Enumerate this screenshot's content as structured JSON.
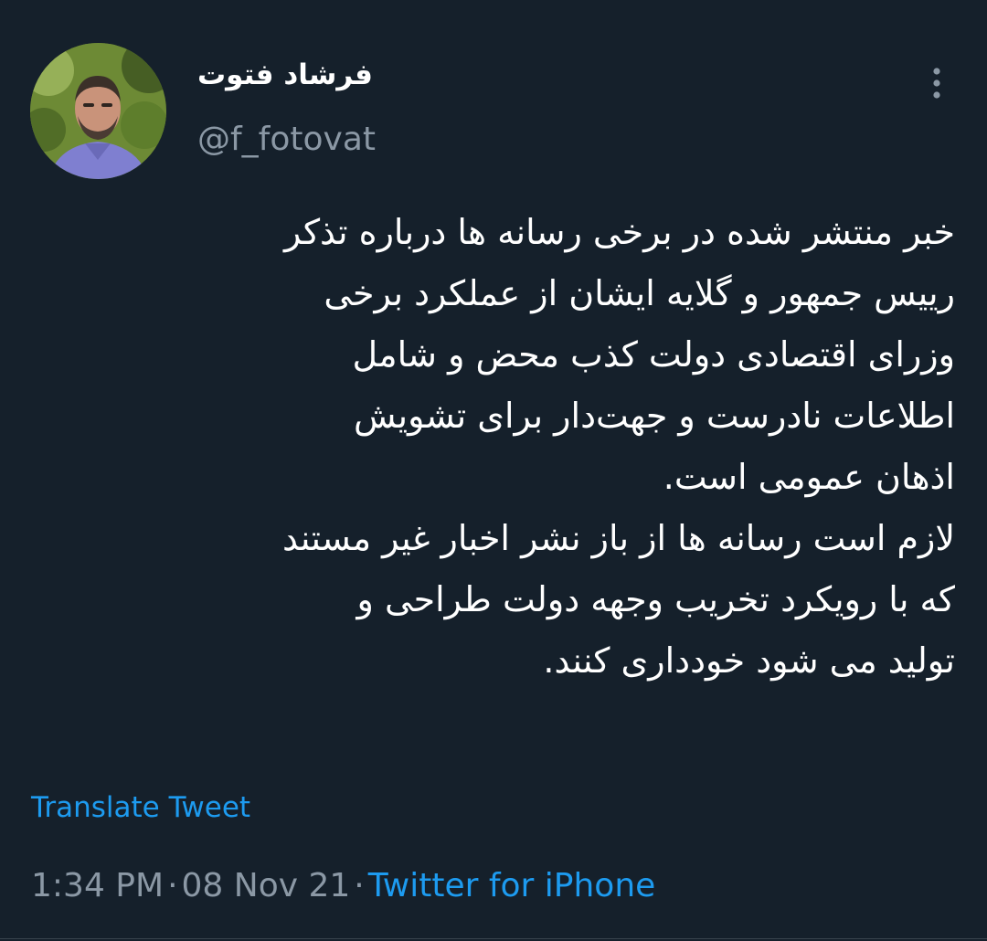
{
  "tweet": {
    "author": {
      "display_name": "فرشاد فتوت",
      "handle": "@f_fotovat"
    },
    "body_lines": [
      "خبر منتشر شده در برخی رسانه ها درباره تذکر",
      "رییس جمهور و گلایه ایشان از عملکرد برخی",
      "وزرای اقتصادی دولت کذب محض و شامل",
      "اطلاعات نادرست و جهت‌دار برای تشویش",
      "اذهان عمومی است.",
      "لازم است رسانه ها از باز نشر اخبار غیر مستند",
      "که با رویکرد تخریب وجهه دولت طراحی و",
      "تولید می شود خودداری کنند."
    ],
    "translate_label": "Translate Tweet",
    "time": "1:34 PM",
    "date": "08 Nov 21",
    "separator": "·",
    "source": "Twitter for iPhone"
  },
  "icons": {
    "more": "more-vertical-icon",
    "avatar": "profile-avatar"
  },
  "colors": {
    "background": "#15202b",
    "text": "#ffffff",
    "secondary_text": "#8b98a5",
    "link": "#1d9bf0"
  }
}
